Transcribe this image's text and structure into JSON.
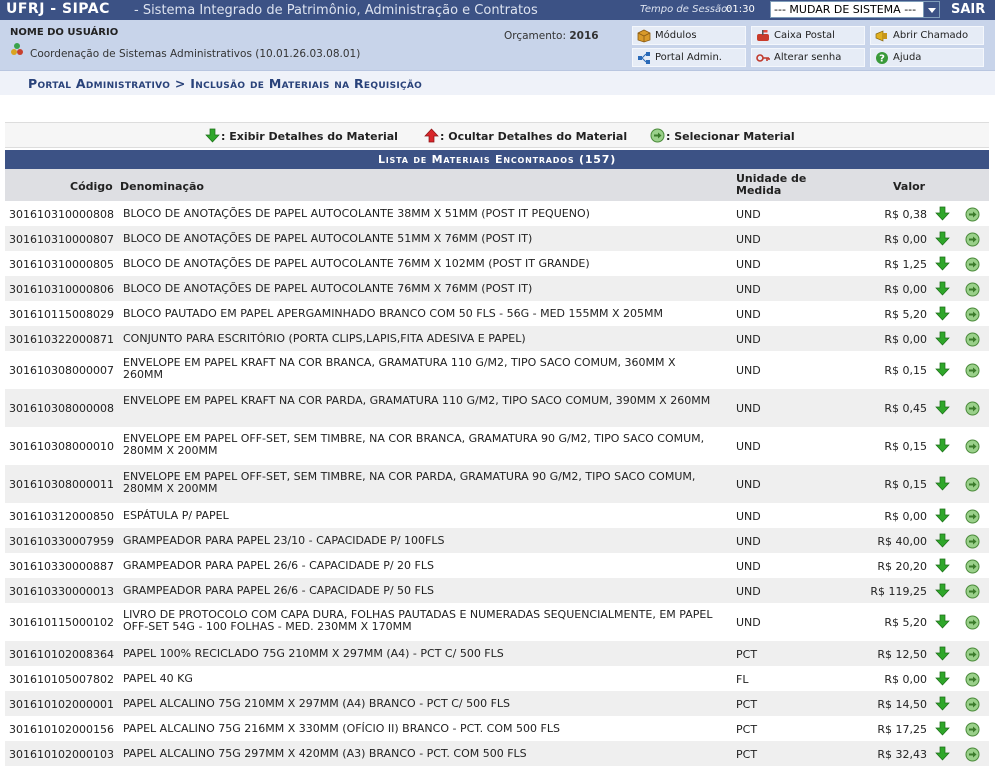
{
  "topbar": {
    "system": "UFRJ - SIPAC",
    "system_name": "- Sistema Integrado de Patrimônio, Administração e Contratos",
    "session_label": "Tempo de Sessão:",
    "session_time": "01:30",
    "change_system": "--- MUDAR DE SISTEMA ---",
    "logout": "SAIR"
  },
  "header": {
    "user_name": "NOME DO USUÁRIO",
    "unit": "Coordenação de Sistemas Administrativos (10.01.26.03.08.01)",
    "budget_label": "Orçamento:",
    "budget_year": "2016",
    "menu": {
      "modulos": "Módulos",
      "caixa_postal": "Caixa Postal",
      "abrir_chamado": "Abrir Chamado",
      "portal_admin": "Portal Admin.",
      "alterar_senha": "Alterar senha",
      "ajuda": "Ajuda"
    }
  },
  "breadcrumb": "Portal Administrativo > Inclusão de Materiais na Requisição",
  "legend": {
    "show": ": Exibir Detalhes do Material",
    "hide": ": Ocultar Detalhes do Material",
    "select": ": Selecionar Material"
  },
  "table": {
    "caption": "Lista de Materiais Encontrados (157)",
    "headers": {
      "code": "Código",
      "name": "Denominação",
      "unit": "Unidade de Medida",
      "value": "Valor"
    },
    "rows": [
      {
        "code": "301610310000808",
        "name": "BLOCO DE ANOTAÇÕES DE PAPEL AUTOCOLANTE 38MM X 51MM (POST IT PEQUENO)",
        "unit": "UND",
        "value": "R$ 0,38"
      },
      {
        "code": "301610310000807",
        "name": "BLOCO DE ANOTAÇÕES DE PAPEL AUTOCOLANTE 51MM X 76MM (POST IT)",
        "unit": "UND",
        "value": "R$ 0,00"
      },
      {
        "code": "301610310000805",
        "name": "BLOCO DE ANOTAÇÕES DE PAPEL AUTOCOLANTE 76MM X 102MM (POST IT GRANDE)",
        "unit": "UND",
        "value": "R$ 1,25"
      },
      {
        "code": "301610310000806",
        "name": "BLOCO DE ANOTAÇÕES DE PAPEL AUTOCOLANTE 76MM X 76MM (POST IT)",
        "unit": "UND",
        "value": "R$ 0,00"
      },
      {
        "code": "301610115008029",
        "name": "BLOCO PAUTADO EM PAPEL APERGAMINHADO BRANCO COM 50 FLS - 56G - MED 155MM X 205MM",
        "unit": "UND",
        "value": "R$ 5,20"
      },
      {
        "code": "301610322000871",
        "name": "CONJUNTO PARA ESCRITÓRIO (PORTA CLIPS,LAPIS,FITA ADESIVA E PAPEL)",
        "unit": "UND",
        "value": "R$ 0,00"
      },
      {
        "code": "301610308000007",
        "name": "ENVELOPE EM PAPEL KRAFT NA COR BRANCA, GRAMATURA 110 G/M2, TIPO SACO COMUM, 360MM X 260MM",
        "unit": "UND",
        "value": "R$ 0,15"
      },
      {
        "code": "301610308000008",
        "name": "ENVELOPE EM PAPEL KRAFT NA COR PARDA, GRAMATURA 110 G/M2, TIPO SACO COMUM, 390MM X 260MM",
        "unit": "UND",
        "value": "R$ 0,45"
      },
      {
        "code": "301610308000010",
        "name": "ENVELOPE EM PAPEL OFF-SET, SEM TIMBRE, NA COR BRANCA, GRAMATURA 90 G/M2, TIPO SACO COMUM, 280MM X 200MM",
        "unit": "UND",
        "value": "R$ 0,15"
      },
      {
        "code": "301610308000011",
        "name": "ENVELOPE EM PAPEL OFF-SET, SEM TIMBRE, NA COR PARDA, GRAMATURA 90 G/M2, TIPO SACO COMUM, 280MM X 200MM",
        "unit": "UND",
        "value": "R$ 0,15"
      },
      {
        "code": "301610312000850",
        "name": "ESPÁTULA P/ PAPEL",
        "unit": "UND",
        "value": "R$ 0,00"
      },
      {
        "code": "301610330007959",
        "name": "GRAMPEADOR PARA PAPEL 23/10 - CAPACIDADE P/ 100FLS",
        "unit": "UND",
        "value": "R$ 40,00"
      },
      {
        "code": "301610330000887",
        "name": "GRAMPEADOR PARA PAPEL 26/6 - CAPACIDADE P/ 20 FLS",
        "unit": "UND",
        "value": "R$ 20,20"
      },
      {
        "code": "301610330000013",
        "name": "GRAMPEADOR PARA PAPEL 26/6 - CAPACIDADE P/ 50 FLS",
        "unit": "UND",
        "value": "R$ 119,25"
      },
      {
        "code": "301610115000102",
        "name": "LIVRO DE PROTOCOLO COM CAPA DURA, FOLHAS PAUTADAS E NUMERADAS SEQUENCIALMENTE, EM PAPEL OFF-SET 54G - 100 FOLHAS - MED. 230MM X 170MM",
        "unit": "UND",
        "value": "R$ 5,20"
      },
      {
        "code": "301610102008364",
        "name": "PAPEL 100% RECICLADO 75G 210MM X 297MM (A4) - PCT C/ 500 FLS",
        "unit": "PCT",
        "value": "R$ 12,50"
      },
      {
        "code": "301610105007802",
        "name": "PAPEL 40 KG",
        "unit": "FL",
        "value": "R$ 0,00"
      },
      {
        "code": "301610102000001",
        "name": "PAPEL ALCALINO 75G 210MM X 297MM (A4) BRANCO - PCT C/ 500 FLS",
        "unit": "PCT",
        "value": "R$ 14,50"
      },
      {
        "code": "301610102000156",
        "name": "PAPEL ALCALINO 75G 216MM X 330MM (OFÍCIO II) BRANCO - PCT. COM 500 FLS",
        "unit": "PCT",
        "value": "R$ 17,25"
      },
      {
        "code": "301610102000103",
        "name": "PAPEL ALCALINO 75G 297MM X 420MM (A3) BRANCO - PCT. COM 500 FLS",
        "unit": "PCT",
        "value": "R$ 32,43"
      }
    ]
  },
  "colors": {
    "topbar": "#3c5285",
    "header_bg": "#c8d4ea",
    "crumb_text": "#29427a",
    "row_alt": "#efefef",
    "arrow_green": "#2fa72a",
    "arrow_red": "#d8262a"
  },
  "icons": {
    "show_details": "green-down-arrow-icon",
    "hide_details": "red-up-arrow-icon",
    "select": "green-circle-arrow-icon"
  }
}
